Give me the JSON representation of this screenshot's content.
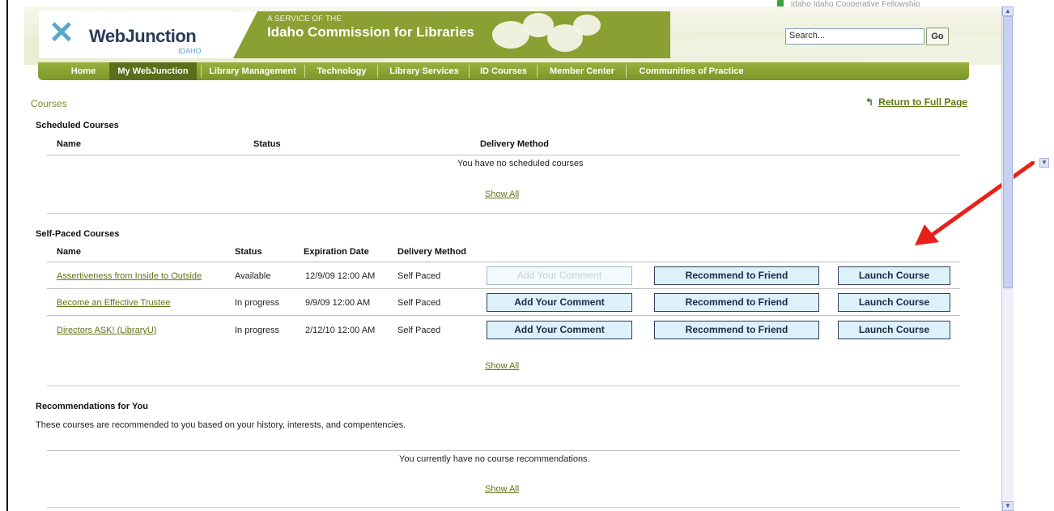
{
  "top_strip_text": "Idaho Idaho Cooperative Fellowship",
  "header": {
    "logo_name": "WebJunction",
    "logo_sub": "IDAHO",
    "service_of": "A SERVICE OF THE",
    "org_name": "Idaho Commission for Libraries",
    "search_placeholder": "Search...",
    "search_value": "Search...",
    "go_label": "Go"
  },
  "nav": [
    "Home",
    "My WebJunction",
    "Library Management",
    "Technology",
    "Library Services",
    "ID Courses",
    "Member Center",
    "Communities of Practice"
  ],
  "nav_active": "My WebJunction",
  "breadcrumb": "Courses",
  "return_link": "Return to Full Page",
  "scheduled": {
    "title": "Scheduled Courses",
    "headers": {
      "name": "Name",
      "status": "Status",
      "delivery": "Delivery Method"
    },
    "empty_message": "You have no scheduled courses",
    "show_all": "Show All"
  },
  "self_paced": {
    "title": "Self-Paced Courses",
    "headers": {
      "name": "Name",
      "status": "Status",
      "expiration": "Expiration Date",
      "delivery": "Delivery Method"
    },
    "rows": [
      {
        "name": "Assertiveness from Inside to Outside",
        "status": "Available",
        "expiration": "12/9/09 12:00 AM",
        "delivery": "Self Paced",
        "comment": "Add Your Comment",
        "recommend": "Recommend to Friend",
        "launch": "Launch Course",
        "comment_disabled": true
      },
      {
        "name": "Become an Effective Trustee",
        "status": "In progress",
        "expiration": "9/9/09 12:00 AM",
        "delivery": "Self Paced",
        "comment": "Add Your Comment",
        "recommend": "Recommend to Friend",
        "launch": "Launch Course",
        "comment_disabled": false
      },
      {
        "name": "Directors ASK! (LibraryU)",
        "status": "In progress",
        "expiration": "2/12/10 12:00 AM",
        "delivery": "Self Paced",
        "comment": "Add Your Comment",
        "recommend": "Recommend to Friend",
        "launch": "Launch Course",
        "comment_disabled": false
      }
    ],
    "show_all": "Show All"
  },
  "recommendations": {
    "title": "Recommendations for You",
    "description": "These courses are recommended to you based on your history, interests, and compentencies.",
    "empty_message": "You currently have no course recommendations.",
    "show_all": "Show All"
  },
  "colors": {
    "nav_green": "#8aa033",
    "link_green": "#5f7416",
    "button_bg": "#dcf1fa",
    "annotation_arrow": "#e8201a"
  }
}
